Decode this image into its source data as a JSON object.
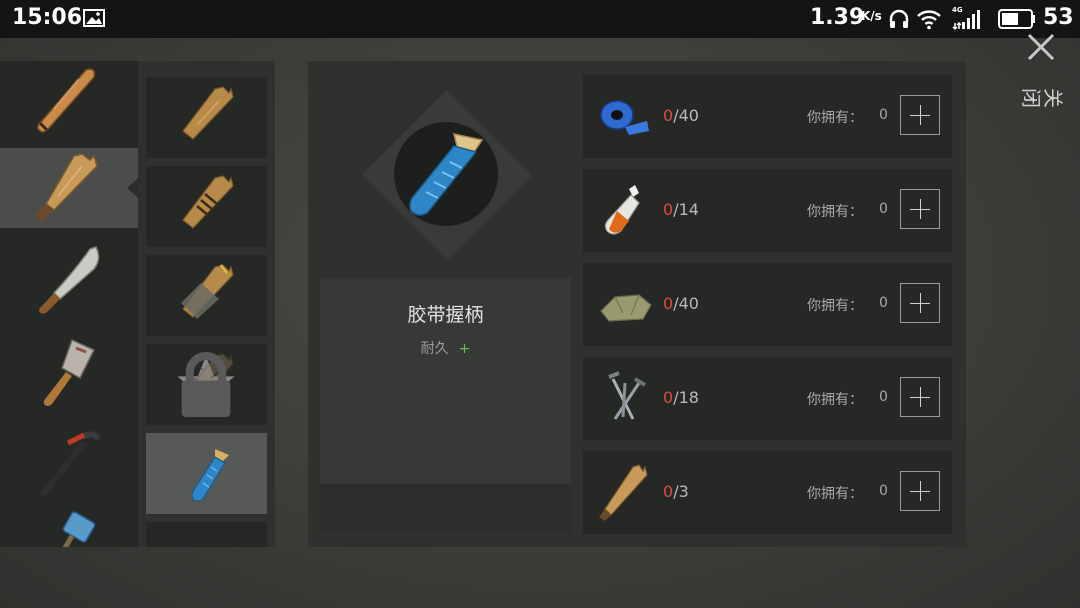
{
  "status_bar": {
    "time": "15:06",
    "speed": "1.39",
    "speed_unit": "K/s",
    "network": "4G",
    "battery": "53"
  },
  "close": {
    "label": "关闭"
  },
  "weapons": [
    {
      "icon": "baseball-bat-icon",
      "selected": false
    },
    {
      "icon": "wooden-club-icon",
      "selected": true
    },
    {
      "icon": "machete-icon",
      "selected": false
    },
    {
      "icon": "cleaver-icon",
      "selected": false
    },
    {
      "icon": "crowbar-icon",
      "selected": false
    },
    {
      "icon": "sledgehammer-icon",
      "selected": false
    }
  ],
  "variants": [
    {
      "icon": "plank-icon",
      "selected": false,
      "starred": false,
      "locked": false
    },
    {
      "icon": "wired-plank-icon",
      "selected": false,
      "starred": false,
      "locked": false
    },
    {
      "icon": "reinforced-plank-icon",
      "selected": false,
      "starred": false,
      "locked": false
    },
    {
      "icon": "spiked-plank-icon",
      "selected": false,
      "starred": true,
      "locked": true
    },
    {
      "icon": "tape-handle-icon",
      "selected": true,
      "starred": false,
      "locked": false
    }
  ],
  "item": {
    "name": "胶带握柄",
    "stat_label": "耐久",
    "stat_plus": "+"
  },
  "requirements": [
    {
      "icon": "duct-tape-icon",
      "have": "0",
      "need": "/40",
      "own_label": "你拥有：",
      "own_value": "0"
    },
    {
      "icon": "glue-bottle-icon",
      "have": "0",
      "need": "/14",
      "own_label": "你拥有：",
      "own_value": "0"
    },
    {
      "icon": "cloth-icon",
      "have": "0",
      "need": "/40",
      "own_label": "你拥有：",
      "own_value": "0"
    },
    {
      "icon": "nails-icon",
      "have": "0",
      "need": "/18",
      "own_label": "你拥有：",
      "own_value": "0"
    },
    {
      "icon": "wood-plank-icon",
      "have": "0",
      "need": "/3",
      "own_label": "你拥有：",
      "own_value": "0"
    }
  ],
  "colors": {
    "accent_red": "#e04a3a",
    "accent_green": "#6cc04a",
    "tape_blue": "#2e86c7"
  }
}
